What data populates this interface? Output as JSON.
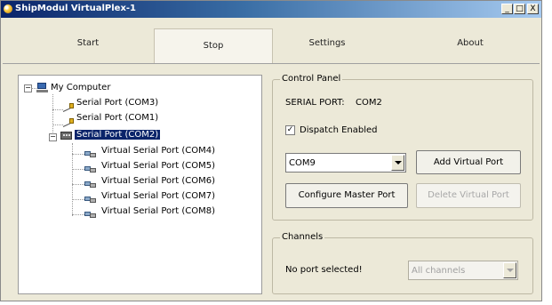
{
  "window": {
    "title": "ShipModul VirtualPlex-1",
    "controls": {
      "minimize": "_",
      "maximize": "□",
      "close": "X"
    }
  },
  "tabs": [
    {
      "label": "Start"
    },
    {
      "label": "Stop"
    },
    {
      "label": "Settings"
    },
    {
      "label": "About"
    }
  ],
  "tree": {
    "root": "My Computer",
    "ports": [
      {
        "label": "Serial Port (COM3)"
      },
      {
        "label": "Serial Port (COM1)"
      },
      {
        "label": "Serial Port (COM2)"
      }
    ],
    "virtual_ports": [
      {
        "label": "Virtual Serial Port (COM4)"
      },
      {
        "label": "Virtual Serial Port (COM5)"
      },
      {
        "label": "Virtual Serial Port (COM6)"
      },
      {
        "label": "Virtual Serial Port (COM7)"
      },
      {
        "label": "Virtual Serial Port (COM8)"
      }
    ],
    "selected": "Serial Port (COM2)"
  },
  "control_panel": {
    "legend": "Control Panel",
    "serial_port_label": "SERIAL PORT:",
    "serial_port_value": "COM2",
    "dispatch_label": "Dispatch Enabled",
    "dispatch_checked": "✓",
    "com_select": "COM9",
    "add_virtual_port": "Add Virtual Port",
    "configure_master_port": "Configure Master Port",
    "delete_virtual_port": "Delete Virtual Port"
  },
  "channels": {
    "legend": "Channels",
    "status": "No port selected!",
    "select_value": "All channels"
  }
}
